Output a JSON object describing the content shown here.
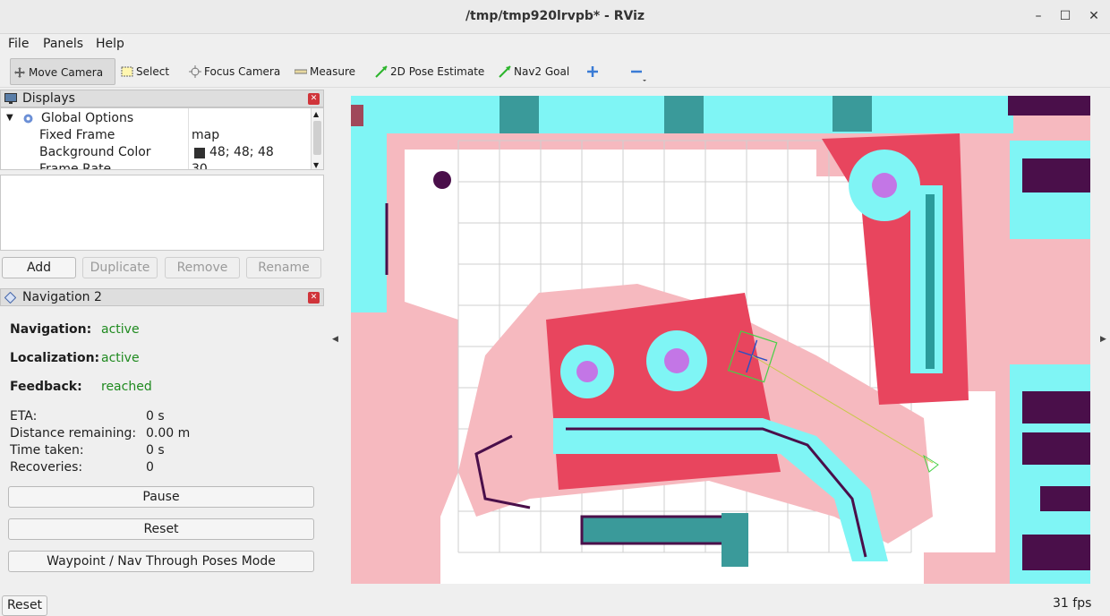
{
  "window": {
    "title": "/tmp/tmp920lrvpb* - RViz"
  },
  "menu": {
    "file": "File",
    "panels": "Panels",
    "help": "Help"
  },
  "toolbar": {
    "tools": [
      {
        "label": "Move Camera",
        "icon": "move-camera-icon"
      },
      {
        "label": "Select",
        "icon": "select-icon"
      },
      {
        "label": "Focus Camera",
        "icon": "focus-camera-icon"
      },
      {
        "label": "Measure",
        "icon": "measure-icon"
      },
      {
        "label": "2D Pose Estimate",
        "icon": "pose-estimate-icon"
      },
      {
        "label": "Nav2 Goal",
        "icon": "nav2-goal-icon"
      }
    ],
    "add_tool_icon": "plus-icon",
    "remove_tool_icon": "minus-icon"
  },
  "displays": {
    "title": "Displays",
    "tree": {
      "global_options": "Global Options",
      "rows": [
        {
          "key": "Fixed Frame",
          "value": "map"
        },
        {
          "key": "Background Color",
          "value": "48; 48; 48"
        },
        {
          "key": "Frame Rate",
          "value": "30"
        }
      ]
    },
    "buttons": {
      "add": "Add",
      "duplicate": "Duplicate",
      "remove": "Remove",
      "rename": "Rename"
    }
  },
  "navigation": {
    "title": "Navigation 2",
    "status": [
      {
        "label": "Navigation:",
        "value": "active"
      },
      {
        "label": "Localization:",
        "value": "active"
      },
      {
        "label": "Feedback:",
        "value": "reached"
      }
    ],
    "metrics": [
      {
        "label": "ETA:",
        "value": "0 s"
      },
      {
        "label": "Distance remaining:",
        "value": "0.00 m"
      },
      {
        "label": "Time taken:",
        "value": "0 s"
      },
      {
        "label": "Recoveries:",
        "value": "0"
      }
    ],
    "buttons": {
      "pause": "Pause",
      "reset": "Reset",
      "waypoint": "Waypoint / Nav Through Poses Mode"
    }
  },
  "colors": {
    "costmap_pink": "#f4b2b8",
    "costmap_cyan": "#7ff5f5",
    "costmap_red": "#e8455e",
    "obstacle": "#4a0f4a",
    "magenta": "#e040e0",
    "active_green": "#1f8a1f"
  },
  "statusbar": {
    "reset": "Reset",
    "fps": "31 fps"
  }
}
